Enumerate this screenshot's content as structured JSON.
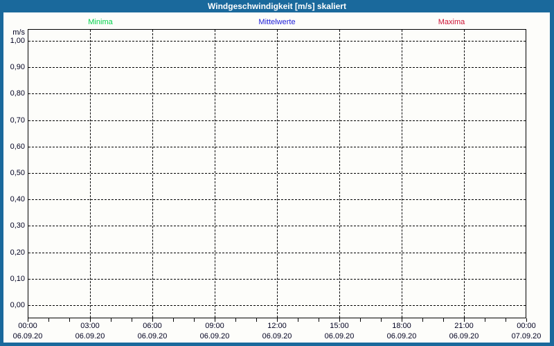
{
  "window": {
    "title": "Windgeschwindigkeit [m/s] skaliert"
  },
  "legend": {
    "items": [
      {
        "label": "Minima",
        "color": "#00d24a"
      },
      {
        "label": "Mittelwerte",
        "color": "#1b1bd8"
      },
      {
        "label": "Maxima",
        "color": "#cc1133"
      }
    ]
  },
  "chart": {
    "y_axis": {
      "unit": "m/s",
      "tick_labels": [
        "1,00",
        "0,90",
        "0,80",
        "0,70",
        "0,60",
        "0,50",
        "0,40",
        "0,30",
        "0,20",
        "0,10",
        "0,00"
      ]
    },
    "x_axis": {
      "ticks": [
        {
          "time": "00:00",
          "date": "06.09.20"
        },
        {
          "time": "03:00",
          "date": "06.09.20"
        },
        {
          "time": "06:00",
          "date": "06.09.20"
        },
        {
          "time": "09:00",
          "date": "06.09.20"
        },
        {
          "time": "12:00",
          "date": "06.09.20"
        },
        {
          "time": "15:00",
          "date": "06.09.20"
        },
        {
          "time": "18:00",
          "date": "06.09.20"
        },
        {
          "time": "21:00",
          "date": "06.09.20"
        },
        {
          "time": "00:00",
          "date": "07.09.20"
        }
      ]
    }
  },
  "chart_data": {
    "type": "line",
    "title": "Windgeschwindigkeit [m/s] skaliert",
    "xlabel": "",
    "ylabel": "m/s",
    "ylim": [
      0.0,
      1.0
    ],
    "y_tick_step": 0.1,
    "y_tick_labels": [
      "1,00",
      "0,90",
      "0,80",
      "0,70",
      "0,60",
      "0,50",
      "0,40",
      "0,30",
      "0,20",
      "0,10",
      "0,00"
    ],
    "x": [
      "00:00",
      "03:00",
      "06:00",
      "09:00",
      "12:00",
      "15:00",
      "18:00",
      "21:00",
      "00:00"
    ],
    "x_dates": [
      "06.09.20",
      "06.09.20",
      "06.09.20",
      "06.09.20",
      "06.09.20",
      "06.09.20",
      "06.09.20",
      "06.09.20",
      "07.09.20"
    ],
    "grid": true,
    "legend_position": "top",
    "series": [
      {
        "name": "Minima",
        "color": "#00d24a",
        "values": []
      },
      {
        "name": "Mittelwerte",
        "color": "#1b1bd8",
        "values": []
      },
      {
        "name": "Maxima",
        "color": "#cc1133",
        "values": []
      }
    ]
  },
  "colors": {
    "titlebar": "#1a699c",
    "frame": "#1a699c",
    "grid": "#000000",
    "plot_background": "#fdfdfa"
  }
}
